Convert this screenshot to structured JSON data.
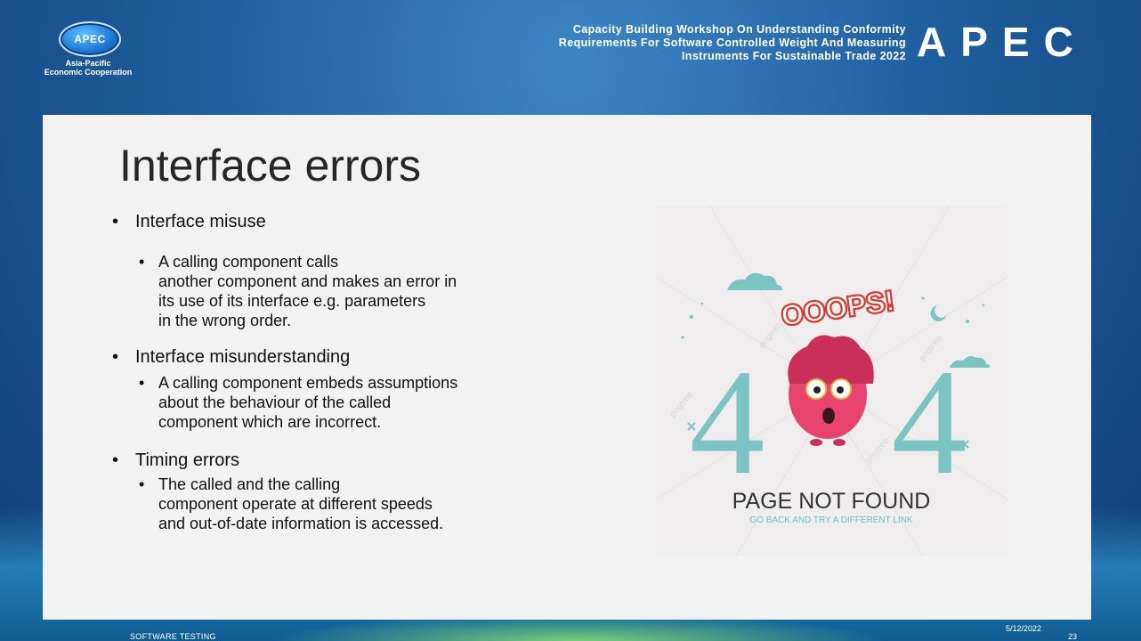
{
  "header": {
    "logo_text": "APEC",
    "logo_subtitle": [
      "Asia-Pacific",
      "Economic Cooperation"
    ],
    "title_lines": [
      "Capacity Building Workshop On Understanding Conformity",
      "Requirements For Software Controlled Weight And Measuring",
      "Instruments For Sustainable Trade 2022"
    ],
    "brand_word": "APEC"
  },
  "slide": {
    "title": "Interface errors",
    "bullets": [
      {
        "label": "Interface misuse",
        "sub": [
          "A calling component calls",
          "another component and makes an error in",
          "its use of its interface e.g. parameters",
          "in the wrong order."
        ]
      },
      {
        "label": "Interface misunderstanding",
        "sub": [
          "A calling component embeds assumptions",
          "about the behaviour of the called",
          "component which are incorrect."
        ]
      },
      {
        "label": "Timing errors",
        "sub": [
          "The called and the calling",
          "component operate at different speeds",
          "and out-of-date information is accessed."
        ]
      }
    ],
    "image": {
      "ooops": "OOOPS!",
      "code": "404",
      "headline": "PAGE NOT FOUND",
      "subline": "GO BACK AND TRY A DIFFERENT LINK",
      "watermark": "pngtree"
    }
  },
  "footer": {
    "left": "SOFTWARE TESTING",
    "date": "5/12/2022",
    "page": "23"
  },
  "colors": {
    "teal": "#6fbec0",
    "pink": "#e8426e",
    "red_text": "#d7382f",
    "card_bg": "#f2f2f2"
  }
}
